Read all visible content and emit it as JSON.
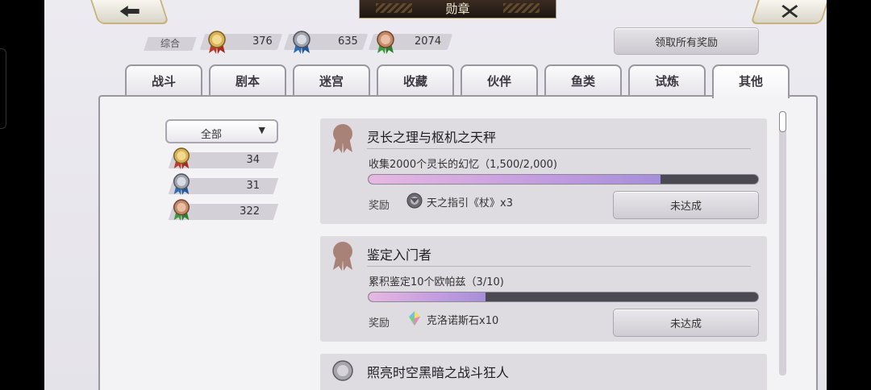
{
  "header": {
    "title": "勋章",
    "back_label": "back",
    "close_label": "close"
  },
  "summary": {
    "label": "综合",
    "gold_count": "376",
    "silver_count": "635",
    "bronze_count": "2074",
    "claim_all_label": "领取所有奖励"
  },
  "tabs": [
    {
      "label": "战斗",
      "active": false
    },
    {
      "label": "剧本",
      "active": false
    },
    {
      "label": "迷宫",
      "active": false
    },
    {
      "label": "收藏",
      "active": false
    },
    {
      "label": "伙伴",
      "active": false
    },
    {
      "label": "鱼类",
      "active": false
    },
    {
      "label": "试炼",
      "active": false
    },
    {
      "label": "其他",
      "active": true
    }
  ],
  "filter": {
    "selected": "全部",
    "counts": {
      "gold": "34",
      "silver": "31",
      "bronze": "322"
    }
  },
  "achievements": [
    {
      "title": "灵长之理与枢机之天秤",
      "description": "收集2000个灵长的幻忆（1,500/2,000)",
      "progress": 0.75,
      "reward_label": "奖励",
      "reward_text": "天之指引《杖》x3",
      "reward_icon": "orb-icon",
      "status": "未达成"
    },
    {
      "title": "鉴定入门者",
      "description": "累积鉴定10个欧帕兹（3/10)",
      "progress": 0.3,
      "reward_label": "奖励",
      "reward_text": "克洛诺斯石x10",
      "reward_icon": "crystal-icon",
      "status": "未达成"
    },
    {
      "title": "照亮时空黑暗之战斗狂人"
    }
  ],
  "colors": {
    "gold_ribbon": "#c0392b",
    "silver_ribbon": "#2e6db4",
    "bronze_ribbon": "#3b9a3b",
    "progress_fill": "#c39ce0",
    "title_plate": "#2a1f18"
  }
}
